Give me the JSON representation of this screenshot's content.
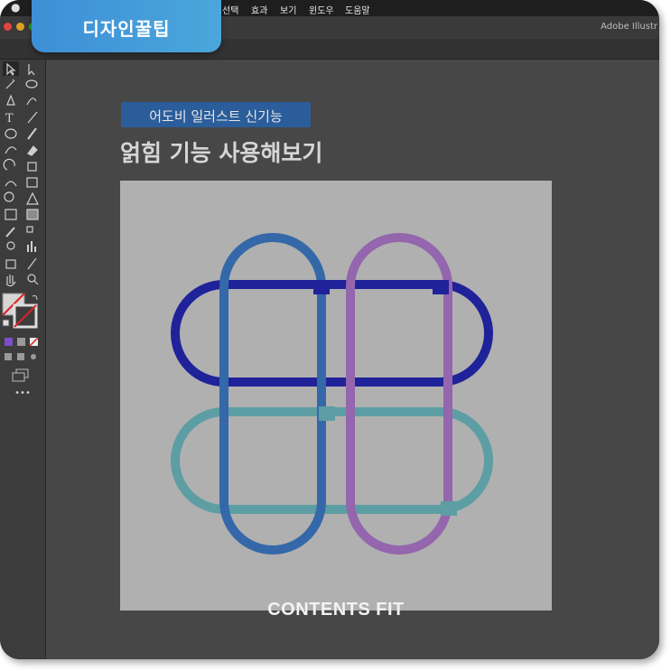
{
  "badge": {
    "label": "디자인꿀팁"
  },
  "menubar": {
    "items": [
      "선택",
      "효과",
      "보기",
      "윈도우",
      "도움말"
    ]
  },
  "window": {
    "title": "Adobe Illustr",
    "traffic_lights": {
      "close": "#e0443e",
      "minimize": "#dea123",
      "zoom": "#1aab29"
    }
  },
  "content": {
    "tag": "어도비 일러스트 신기능",
    "headline": "얽힘 기능 사용해보기",
    "watermark": "CONTENTS FIT"
  },
  "artwork": {
    "shapes": [
      {
        "name": "navy-horizontal-capsule",
        "color": "#20229a"
      },
      {
        "name": "teal-horizontal-capsule",
        "color": "#5c9ea3"
      },
      {
        "name": "blue-vertical-capsule",
        "color": "#3468a8"
      },
      {
        "name": "purple-vertical-capsule",
        "color": "#9466ad"
      }
    ]
  },
  "toolbar": {
    "icons": [
      "selection-tool-icon",
      "direct-selection-tool-icon",
      "magic-wand-icon",
      "lasso-icon",
      "pen-tool-icon",
      "curvature-tool-icon",
      "type-tool-icon",
      "line-tool-icon",
      "ellipse-tool-icon",
      "paintbrush-icon",
      "shaper-tool-icon",
      "eraser-icon",
      "rotate-tool-icon",
      "scale-tool-icon",
      "width-tool-icon",
      "free-transform-icon",
      "shape-builder-icon",
      "perspective-grid-icon",
      "mesh-tool-icon",
      "gradient-tool-icon",
      "eyedropper-icon",
      "blend-tool-icon",
      "symbol-sprayer-icon",
      "column-graph-icon",
      "artboard-tool-icon",
      "slice-tool-icon",
      "hand-tool-icon",
      "zoom-tool-icon"
    ],
    "more_label": "•••"
  }
}
